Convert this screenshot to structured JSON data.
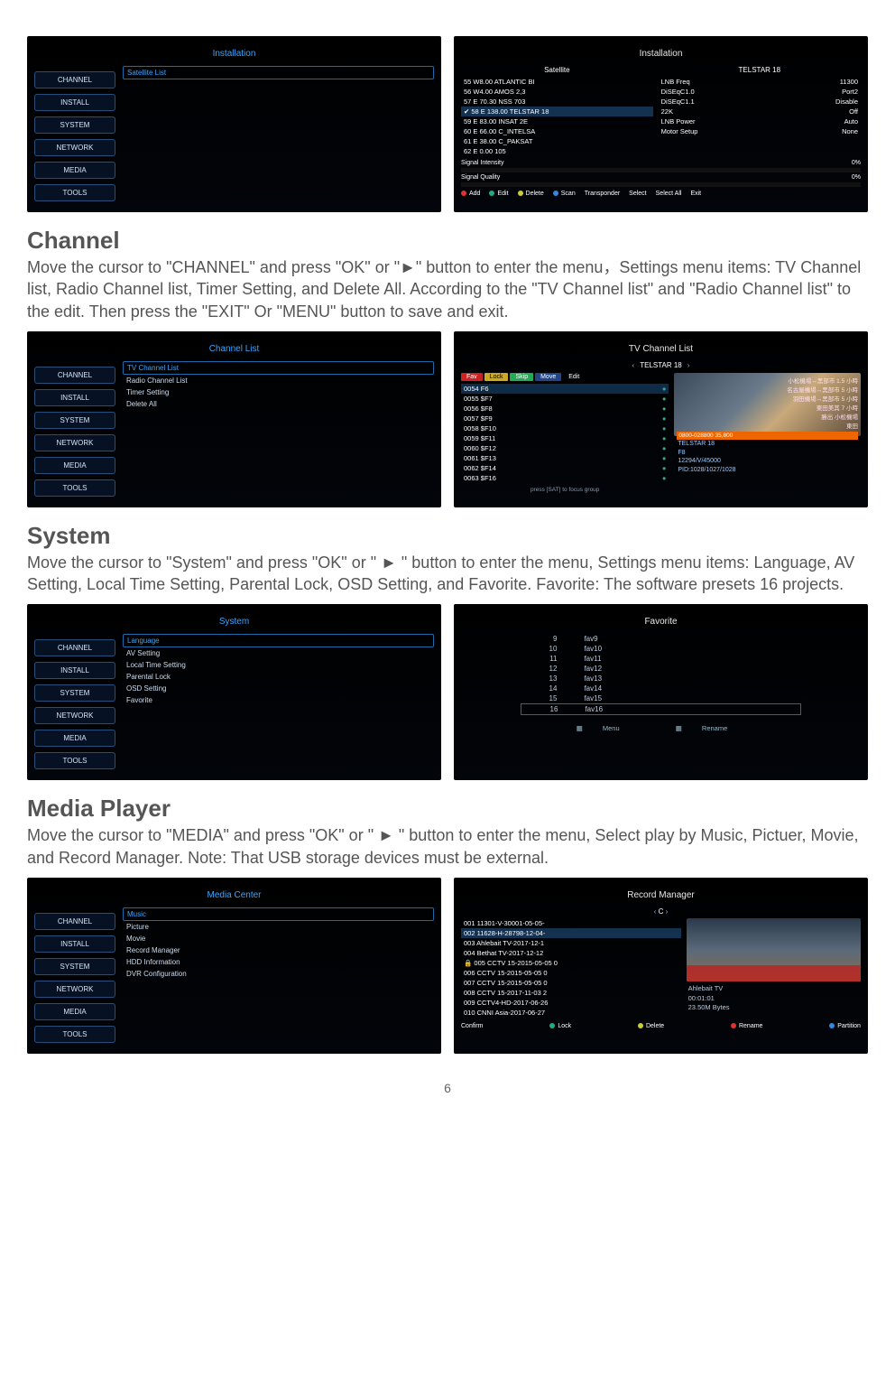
{
  "page_number": "6",
  "sidebar_items": [
    "CHANNEL",
    "INSTALL",
    "SYSTEM",
    "NETWORK",
    "MEDIA",
    "TOOLS"
  ],
  "install1": {
    "title": "Installation",
    "item": "Satellite List"
  },
  "install2": {
    "title": "Installation",
    "sat_header_left": "Satellite",
    "sat_header_right": "TELSTAR 18",
    "sats": [
      "55 W8.00   ATLANTIC BI",
      "56 W4.00   AMOS 2,3",
      "57 E 70.30 NSS 703",
      "✔ 58 E 138.00 TELSTAR 18",
      "59 E 83.00 INSAT 2E",
      "60 E 66.00 C_INTELSA",
      "61 E 38.00 C_PAKSAT",
      "62 E 0.00  105"
    ],
    "params": [
      [
        "LNB Freq",
        "11300"
      ],
      [
        "DiSEqC1.0",
        "Port2"
      ],
      [
        "DiSEqC1.1",
        "Disable"
      ],
      [
        "22K",
        "Off"
      ],
      [
        "LNB Power",
        "Auto"
      ],
      [
        "Motor Setup",
        "None"
      ]
    ],
    "sig_int": "Signal Intensity",
    "sig_qual": "Signal Quality",
    "pct": "0%",
    "legend": [
      "Add",
      "Edit",
      "Delete",
      "Scan",
      "Transponder",
      "Select",
      "Select All",
      "Exit"
    ]
  },
  "section_channel": {
    "heading": "Channel",
    "body": "Move the cursor to \"CHANNEL\" and press \"OK\" or \"►\" button to enter the menu，Settings menu items: TV Channel list,  Radio Channel list, Timer Setting, and Delete All. According to the \"TV Channel list\" and \"Radio Channel list\" to the edit. Then press the \"EXIT\" Or \"MENU\"  button to save and exit."
  },
  "chanlist": {
    "title": "Channel List",
    "items": [
      "TV Channel List",
      "Radio Channel List",
      "Timer Setting",
      "Delete All"
    ]
  },
  "tvchan": {
    "title": "TV Channel List",
    "satname": "TELSTAR 18",
    "chips": [
      "Fav",
      "Lock",
      "Skip",
      "Move",
      "Edit"
    ],
    "channels": [
      "0054 F6",
      "0055 $F7",
      "0056 $F8",
      "0057 $F9",
      "0058 $F10",
      "0059 $F11",
      "0060 $F12",
      "0061 $F13",
      "0062 $F14",
      "0063 $F16"
    ],
    "footer": "press [SAT] to focus group",
    "preview_lines": [
      "小松機場↔黑部市  1.5 小時",
      "名古屋機場↔黑部市 5 小時",
      "羽田機場↔黑部市   5 小時",
      "東田美其  7 小時",
      "勝出  小松機場",
      "東田"
    ],
    "orange": "0800-028800  35,800",
    "info": [
      "TELSTAR 18",
      "F8",
      "12294/V/45000",
      "PID:1028/1027/1028"
    ]
  },
  "section_system": {
    "heading": "System",
    "body": "Move the cursor to \"System\" and press \"OK\" or \" ► \" button to enter the menu, Settings menu items: Language, AV Setting, Local Time Setting, Parental Lock, OSD Setting, and Favorite.  Favorite: The software presets 16 projects."
  },
  "system": {
    "title": "System",
    "items": [
      "Language",
      "AV Setting",
      "Local Time Setting",
      "Parental Lock",
      "OSD Setting",
      "Favorite"
    ]
  },
  "favorite": {
    "title": "Favorite",
    "rows": [
      [
        "9",
        "fav9"
      ],
      [
        "10",
        "fav10"
      ],
      [
        "11",
        "fav11"
      ],
      [
        "12",
        "fav12"
      ],
      [
        "13",
        "fav13"
      ],
      [
        "14",
        "fav14"
      ],
      [
        "15",
        "fav15"
      ],
      [
        "16",
        "fav16"
      ]
    ],
    "menu": "Menu",
    "rename": "Rename"
  },
  "section_media": {
    "heading": "Media Player",
    "body": "Move the cursor to \"MEDIA\" and press \"OK\" or \" ► \" button to enter the menu, Select play by Music, Pictuer, Movie, and Record Manager. Note: That USB storage devices must be external."
  },
  "media": {
    "title": "Media Center",
    "items": [
      "Music",
      "Picture",
      "Movie",
      "Record Manager",
      "HDD Information",
      "DVR Configuration"
    ]
  },
  "record": {
    "title": "Record Manager",
    "drive": "C",
    "files": [
      "001 11301-V-30001-05-05-",
      "002 11628-H-28798-12-04-",
      "003 Ahlebait TV-2017-12-1",
      "004 Bethat TV-2017-12-12",
      "005 CCTV 15-2015-05-05 0",
      "006 CCTV 15-2015-05-05 0",
      "007 CCTV 15-2015-05-05 0",
      "008 CCTV 15-2017-11-03 2",
      "009 CCTV4-HD-2017-06-26",
      "010 CNNI Asia-2017-06-27"
    ],
    "info": [
      "Ahlebait TV",
      "00:01:01",
      "23.50M Bytes"
    ],
    "legend": [
      "Confirm",
      "Lock",
      "Delete",
      "Rename",
      "Partition"
    ]
  }
}
